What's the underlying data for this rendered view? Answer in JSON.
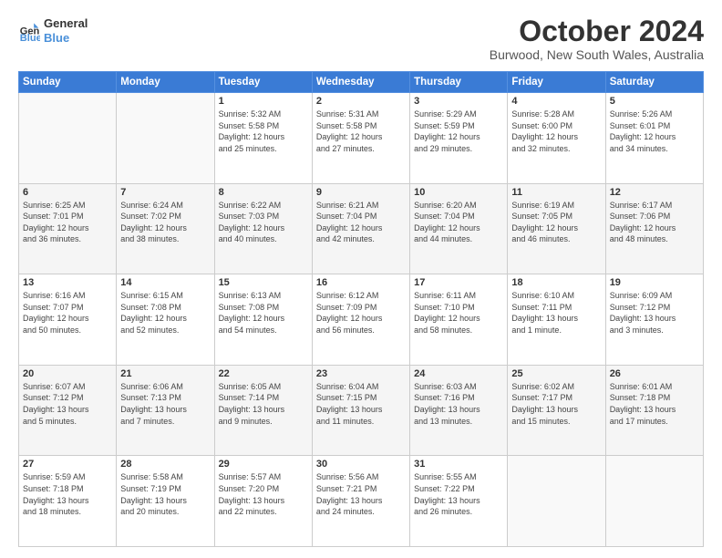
{
  "header": {
    "logo_line1": "General",
    "logo_line2": "Blue",
    "title": "October 2024",
    "subtitle": "Burwood, New South Wales, Australia"
  },
  "days_header": [
    "Sunday",
    "Monday",
    "Tuesday",
    "Wednesday",
    "Thursday",
    "Friday",
    "Saturday"
  ],
  "weeks": [
    [
      {
        "day": "",
        "detail": ""
      },
      {
        "day": "",
        "detail": ""
      },
      {
        "day": "1",
        "detail": "Sunrise: 5:32 AM\nSunset: 5:58 PM\nDaylight: 12 hours\nand 25 minutes."
      },
      {
        "day": "2",
        "detail": "Sunrise: 5:31 AM\nSunset: 5:58 PM\nDaylight: 12 hours\nand 27 minutes."
      },
      {
        "day": "3",
        "detail": "Sunrise: 5:29 AM\nSunset: 5:59 PM\nDaylight: 12 hours\nand 29 minutes."
      },
      {
        "day": "4",
        "detail": "Sunrise: 5:28 AM\nSunset: 6:00 PM\nDaylight: 12 hours\nand 32 minutes."
      },
      {
        "day": "5",
        "detail": "Sunrise: 5:26 AM\nSunset: 6:01 PM\nDaylight: 12 hours\nand 34 minutes."
      }
    ],
    [
      {
        "day": "6",
        "detail": "Sunrise: 6:25 AM\nSunset: 7:01 PM\nDaylight: 12 hours\nand 36 minutes."
      },
      {
        "day": "7",
        "detail": "Sunrise: 6:24 AM\nSunset: 7:02 PM\nDaylight: 12 hours\nand 38 minutes."
      },
      {
        "day": "8",
        "detail": "Sunrise: 6:22 AM\nSunset: 7:03 PM\nDaylight: 12 hours\nand 40 minutes."
      },
      {
        "day": "9",
        "detail": "Sunrise: 6:21 AM\nSunset: 7:04 PM\nDaylight: 12 hours\nand 42 minutes."
      },
      {
        "day": "10",
        "detail": "Sunrise: 6:20 AM\nSunset: 7:04 PM\nDaylight: 12 hours\nand 44 minutes."
      },
      {
        "day": "11",
        "detail": "Sunrise: 6:19 AM\nSunset: 7:05 PM\nDaylight: 12 hours\nand 46 minutes."
      },
      {
        "day": "12",
        "detail": "Sunrise: 6:17 AM\nSunset: 7:06 PM\nDaylight: 12 hours\nand 48 minutes."
      }
    ],
    [
      {
        "day": "13",
        "detail": "Sunrise: 6:16 AM\nSunset: 7:07 PM\nDaylight: 12 hours\nand 50 minutes."
      },
      {
        "day": "14",
        "detail": "Sunrise: 6:15 AM\nSunset: 7:08 PM\nDaylight: 12 hours\nand 52 minutes."
      },
      {
        "day": "15",
        "detail": "Sunrise: 6:13 AM\nSunset: 7:08 PM\nDaylight: 12 hours\nand 54 minutes."
      },
      {
        "day": "16",
        "detail": "Sunrise: 6:12 AM\nSunset: 7:09 PM\nDaylight: 12 hours\nand 56 minutes."
      },
      {
        "day": "17",
        "detail": "Sunrise: 6:11 AM\nSunset: 7:10 PM\nDaylight: 12 hours\nand 58 minutes."
      },
      {
        "day": "18",
        "detail": "Sunrise: 6:10 AM\nSunset: 7:11 PM\nDaylight: 13 hours\nand 1 minute."
      },
      {
        "day": "19",
        "detail": "Sunrise: 6:09 AM\nSunset: 7:12 PM\nDaylight: 13 hours\nand 3 minutes."
      }
    ],
    [
      {
        "day": "20",
        "detail": "Sunrise: 6:07 AM\nSunset: 7:12 PM\nDaylight: 13 hours\nand 5 minutes."
      },
      {
        "day": "21",
        "detail": "Sunrise: 6:06 AM\nSunset: 7:13 PM\nDaylight: 13 hours\nand 7 minutes."
      },
      {
        "day": "22",
        "detail": "Sunrise: 6:05 AM\nSunset: 7:14 PM\nDaylight: 13 hours\nand 9 minutes."
      },
      {
        "day": "23",
        "detail": "Sunrise: 6:04 AM\nSunset: 7:15 PM\nDaylight: 13 hours\nand 11 minutes."
      },
      {
        "day": "24",
        "detail": "Sunrise: 6:03 AM\nSunset: 7:16 PM\nDaylight: 13 hours\nand 13 minutes."
      },
      {
        "day": "25",
        "detail": "Sunrise: 6:02 AM\nSunset: 7:17 PM\nDaylight: 13 hours\nand 15 minutes."
      },
      {
        "day": "26",
        "detail": "Sunrise: 6:01 AM\nSunset: 7:18 PM\nDaylight: 13 hours\nand 17 minutes."
      }
    ],
    [
      {
        "day": "27",
        "detail": "Sunrise: 5:59 AM\nSunset: 7:18 PM\nDaylight: 13 hours\nand 18 minutes."
      },
      {
        "day": "28",
        "detail": "Sunrise: 5:58 AM\nSunset: 7:19 PM\nDaylight: 13 hours\nand 20 minutes."
      },
      {
        "day": "29",
        "detail": "Sunrise: 5:57 AM\nSunset: 7:20 PM\nDaylight: 13 hours\nand 22 minutes."
      },
      {
        "day": "30",
        "detail": "Sunrise: 5:56 AM\nSunset: 7:21 PM\nDaylight: 13 hours\nand 24 minutes."
      },
      {
        "day": "31",
        "detail": "Sunrise: 5:55 AM\nSunset: 7:22 PM\nDaylight: 13 hours\nand 26 minutes."
      },
      {
        "day": "",
        "detail": ""
      },
      {
        "day": "",
        "detail": ""
      }
    ]
  ]
}
